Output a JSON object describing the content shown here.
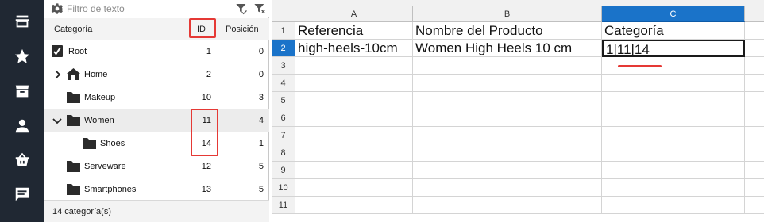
{
  "sidebar_icons": [
    "store-icon",
    "star-icon",
    "archive-icon",
    "user-icon",
    "basket-icon",
    "message-icon"
  ],
  "filter": {
    "placeholder": "Filtro de texto"
  },
  "category_table": {
    "headers": {
      "category": "Categoría",
      "id": "ID",
      "position": "Posición"
    },
    "rows": [
      {
        "name": "Root",
        "id": "1",
        "position": "0",
        "icon": "root-check-icon",
        "expander": ""
      },
      {
        "name": "Home",
        "id": "2",
        "position": "0",
        "icon": "home-icon",
        "expander": "collapsed"
      },
      {
        "name": "Makeup",
        "id": "10",
        "position": "3",
        "icon": "folder-icon",
        "expander": ""
      },
      {
        "name": "Women",
        "id": "11",
        "position": "4",
        "icon": "folder-icon",
        "expander": "expanded"
      },
      {
        "name": "Shoes",
        "id": "14",
        "position": "1",
        "icon": "folder-icon",
        "expander": ""
      },
      {
        "name": "Serveware",
        "id": "12",
        "position": "5",
        "icon": "folder-icon",
        "expander": ""
      },
      {
        "name": "Smartphones",
        "id": "13",
        "position": "5",
        "icon": "folder-icon",
        "expander": ""
      }
    ],
    "footer": "14 categoría(s)"
  },
  "spreadsheet": {
    "columns": [
      "A",
      "B",
      "C"
    ],
    "active_column": "C",
    "row_numbers": [
      "1",
      "2",
      "3",
      "4",
      "5",
      "6",
      "7",
      "8",
      "9",
      "10",
      "11"
    ],
    "active_row": "2",
    "cells": {
      "A1": "Referencia",
      "B1": "Nombre del Producto",
      "C1": "Categoría",
      "A2": "high-heels-10cm",
      "B2": "Women High Heels 10 cm",
      "C2": "1|11|14"
    }
  },
  "colors": {
    "sidebar_bg": "#202833",
    "accent": "#1a73c9",
    "highlight": "#e53935"
  }
}
